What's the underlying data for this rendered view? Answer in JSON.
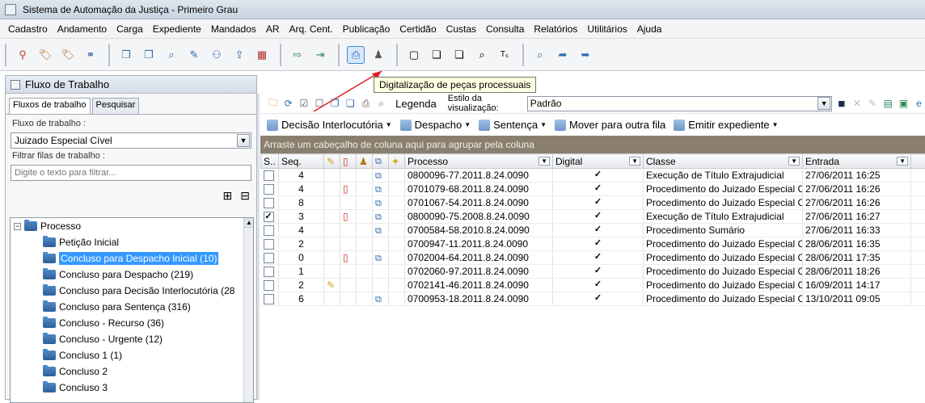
{
  "window": {
    "title": "Sistema de Automação da Justiça - Primeiro Grau"
  },
  "menu": [
    "Cadastro",
    "Andamento",
    "Carga",
    "Expediente",
    "Mandados",
    "AR",
    "Arq. Cent.",
    "Publicação",
    "Certidão",
    "Custas",
    "Consulta",
    "Relatórios",
    "Utilitários",
    "Ajuda"
  ],
  "tooltip": "Digitalização de peças processuais",
  "left_pane": {
    "title": "Fluxo de Trabalho",
    "tabs": [
      "Fluxos de trabalho",
      "Pesquisar"
    ],
    "workflow_label": "Fluxo de trabalho :",
    "workflow_value": "Juizado Especial Cível",
    "filter_label": "Filtrar filas de trabalho :",
    "filter_placeholder": "Digite o texto para filtrar...",
    "tree_root": "Processo",
    "tree_items": [
      "Petição Inicial",
      "Concluso para Despacho Inicial (10)",
      "Concluso para Despacho (219)",
      "Concluso para Decisão Interlocutória (28",
      "Concluso para Sentença (316)",
      "Concluso - Recurso (36)",
      "Concluso - Urgente (12)",
      "Concluso 1 (1)",
      "Concluso 2",
      "Concluso 3"
    ],
    "selected_index": 1
  },
  "right_pane": {
    "legenda": "Legenda",
    "style_label": "Estilo da visualização:",
    "style_value": "Padrão",
    "actions": [
      "Decisão Interlocutória",
      "Despacho",
      "Sentença",
      "Mover para outra fila",
      "Emitir expediente"
    ],
    "group_hint": "Arraste um cabeçalho de coluna aqui para agrupar pela coluna",
    "columns": {
      "s": "S..",
      "seq": "Seq.",
      "processo": "Processo",
      "digital": "Digital",
      "classe": "Classe",
      "entrada": "Entrada"
    },
    "rows": [
      {
        "checked": false,
        "seq": "4",
        "doc": false,
        "dig": true,
        "note": false,
        "processo": "0800096-77.2011.8.24.0090",
        "digital": true,
        "classe": "Execução de Título Extrajudicial",
        "entrada": "27/06/2011 16:25"
      },
      {
        "checked": false,
        "seq": "4",
        "doc": true,
        "dig": true,
        "note": false,
        "processo": "0701079-68.2011.8.24.0090",
        "digital": true,
        "classe": "Procedimento do Juizado Especial Cí...",
        "entrada": "27/06/2011 16:26"
      },
      {
        "checked": false,
        "seq": "8",
        "doc": false,
        "dig": true,
        "note": false,
        "processo": "0701067-54.2011.8.24.0090",
        "digital": true,
        "classe": "Procedimento do Juizado Especial Cí...",
        "entrada": "27/06/2011 16:26"
      },
      {
        "checked": true,
        "seq": "3",
        "doc": true,
        "dig": true,
        "note": false,
        "processo": "0800090-75.2008.8.24.0090",
        "digital": true,
        "classe": "Execução de Título Extrajudicial",
        "entrada": "27/06/2011 16:27"
      },
      {
        "checked": false,
        "seq": "4",
        "doc": false,
        "dig": true,
        "note": false,
        "processo": "0700584-58.2010.8.24.0090",
        "digital": true,
        "classe": "Procedimento Sumário",
        "entrada": "27/06/2011 16:33"
      },
      {
        "checked": false,
        "seq": "2",
        "doc": false,
        "dig": false,
        "note": false,
        "processo": "0700947-11.2011.8.24.0090",
        "digital": true,
        "classe": "Procedimento do Juizado Especial Cí...",
        "entrada": "28/06/2011 16:35"
      },
      {
        "checked": false,
        "seq": "0",
        "doc": true,
        "dig": true,
        "note": false,
        "processo": "0702004-64.2011.8.24.0090",
        "digital": true,
        "classe": "Procedimento do Juizado Especial Cí...",
        "entrada": "28/06/2011 17:35"
      },
      {
        "checked": false,
        "seq": "1",
        "doc": false,
        "dig": false,
        "note": false,
        "processo": "0702060-97.2011.8.24.0090",
        "digital": true,
        "classe": "Procedimento do Juizado Especial Cí...",
        "entrada": "28/06/2011 18:26"
      },
      {
        "checked": false,
        "seq": "2",
        "doc": false,
        "dig": false,
        "note": true,
        "processo": "0702141-46.2011.8.24.0090",
        "digital": true,
        "classe": "Procedimento do Juizado Especial Cí...",
        "entrada": "16/09/2011 14:17"
      },
      {
        "checked": false,
        "seq": "6",
        "doc": false,
        "dig": true,
        "note": false,
        "processo": "0700953-18.2011.8.24.0090",
        "digital": true,
        "classe": "Procedimento do Juizado Especial Cí...",
        "entrada": "13/10/2011 09:05"
      }
    ]
  },
  "colors": {
    "selection": "#3399ff",
    "group_bar": "#8a7f6e",
    "tooltip_bg": "#ffffe1",
    "arrow": "#e02020"
  }
}
